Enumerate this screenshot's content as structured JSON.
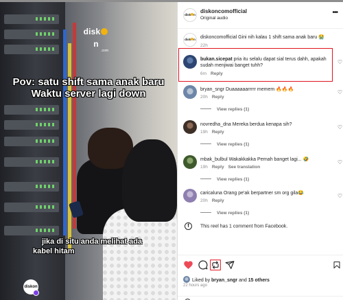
{
  "video": {
    "logo_text_left": "disk",
    "logo_text_right": "n",
    "logo_subtext": ".com",
    "caption_top_line1": "Pov: satu shift sama anak baru",
    "caption_top_line2": "Waktu server lagi down",
    "caption_bottom_line1": "jika di situ anda melihat ada",
    "caption_bottom_line2": "kabel hitam",
    "corner_logo_text": "diskon"
  },
  "header": {
    "avatar_text": "disk n",
    "username": "diskoncomofficial",
    "audio": "Original audio",
    "more_icon": "more-horizontal-icon"
  },
  "caption_post": {
    "username": "diskoncomofficial",
    "text": "Gini nih kalau 1 shift sama anak baru 😭",
    "time": "22h"
  },
  "comments": [
    {
      "username": "bukan.sicepat",
      "text": "pria itu selalu dapat sial terus dahh, apakah sudah menjiwai banget tuhh?",
      "time": "6m",
      "reply_label": "Reply",
      "replies": ""
    },
    {
      "username": "bryan_sngr",
      "text": "Duaaaaaarrrrr memem 🔥🔥🔥",
      "time": "20h",
      "reply_label": "Reply",
      "replies": "View replies (1)"
    },
    {
      "username": "novredha_dna",
      "text": "Mereka berdua kenapa sih?",
      "time": "19h",
      "reply_label": "Reply",
      "replies": "View replies (1)"
    },
    {
      "username": "mbak_bulbul",
      "text": "Wakakkakka Pernah banget lagi... 🤣",
      "time": "19h",
      "reply_label": "Reply",
      "translation": "See translation",
      "replies": "View replies (1)"
    },
    {
      "username": "caricaluna",
      "text": "Orang pe'ak berpartner sm org gila😂",
      "time": "20h",
      "reply_label": "Reply",
      "replies": "View replies (1)"
    }
  ],
  "facebook_note": "This reel has 1 comment from Facebook.",
  "likes": {
    "prefix": "Liked by",
    "user": "bryan_sngr",
    "joiner": "and",
    "others": "15 others",
    "time": "22 hours ago"
  },
  "icons": {
    "like": "heart-filled-icon",
    "comment": "comment-bubble-icon",
    "repost": "repost-icon",
    "share": "paper-plane-icon",
    "save": "bookmark-icon"
  },
  "colors": {
    "heart": "#ed4956",
    "highlight": "#e0121d",
    "logo_accent": "#f2b30f"
  }
}
